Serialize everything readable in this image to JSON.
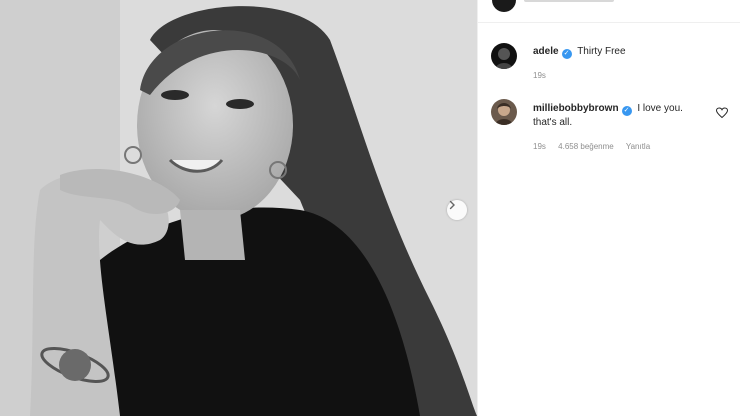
{
  "post": {
    "image_alt": "Black and white portrait photo"
  },
  "caption": {
    "username": "adele",
    "text": "Thirty Free",
    "time": "19s"
  },
  "comments": [
    {
      "username": "milliebobbybrown",
      "text_line1": "I love you.",
      "text_line2": "that's all.",
      "time": "19s",
      "likes": "4.658 beğenme",
      "reply_label": "Yanıtla"
    }
  ],
  "icons": {
    "verified": "verified-badge-icon",
    "heart": "heart-outline-icon",
    "next": "chevron-right-icon"
  },
  "colors": {
    "verified": "#3897f0",
    "meta_text": "#8e8e8e",
    "primary_text": "#262626"
  }
}
